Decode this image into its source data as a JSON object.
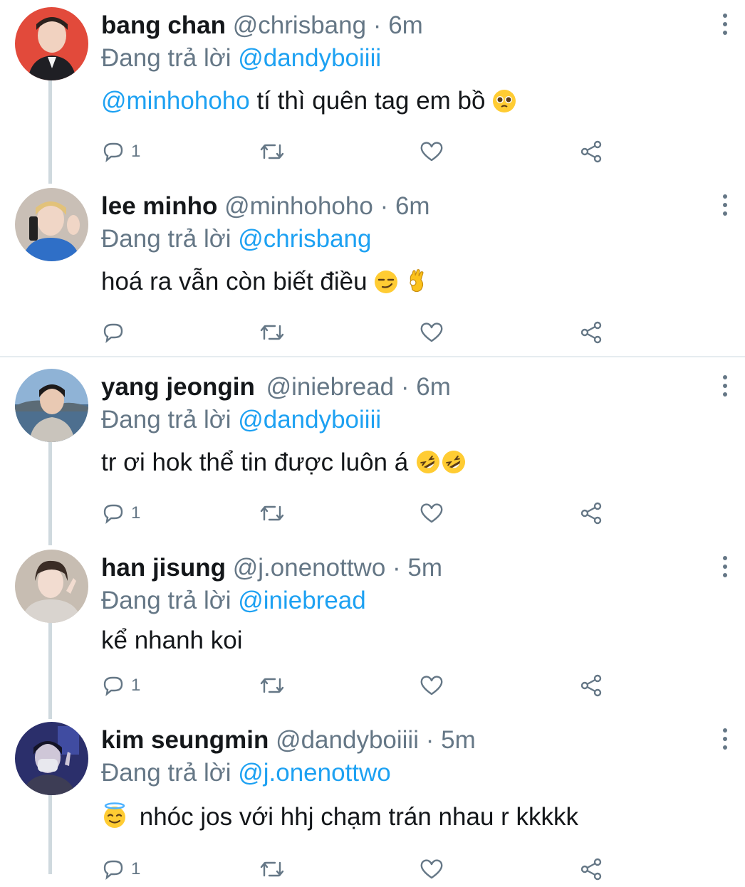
{
  "tweets": [
    {
      "name": "bang chan",
      "handle": "@chrisbang",
      "dot": "·",
      "time": "6m",
      "reply_prefix": "Đang trả lời",
      "reply_to": "@dandyboiiii",
      "text_mention": "@minhohoho",
      "text": " tí thì quên tag em bồ",
      "emojis": [
        "pleading-face"
      ],
      "reply_count": "1"
    },
    {
      "name": "lee minho",
      "handle": "@minhohoho",
      "dot": "·",
      "time": "6m",
      "reply_prefix": "Đang trả lời",
      "reply_to": "@chrisbang",
      "text_mention": "",
      "text": "hoá ra vẫn còn biết điều",
      "emojis": [
        "smirking-face",
        "ok-hand"
      ],
      "reply_count": ""
    },
    {
      "name": "yang jeongin",
      "handle": "@iniebread",
      "dot": "·",
      "time": "6m",
      "reply_prefix": "Đang trả lời",
      "reply_to": "@dandyboiiii",
      "text_mention": "",
      "text": "tr ơi hok thể tin được luôn á",
      "emojis": [
        "rofl-face",
        "rofl-face"
      ],
      "reply_count": "1"
    },
    {
      "name": "han jisung",
      "handle": "@j.onenottwo",
      "dot": "·",
      "time": "5m",
      "reply_prefix": "Đang trả lời",
      "reply_to": "@iniebread",
      "text_mention": "",
      "text": "kể nhanh koi",
      "emojis": [],
      "reply_count": "1"
    },
    {
      "name": "kim seungmin",
      "handle": "@dandyboiiii",
      "dot": "·",
      "time": "5m",
      "reply_prefix": "Đang trả lời",
      "reply_to": "@j.onenottwo",
      "text_mention": "",
      "text": "nhóc jos với hhj chạm trán nhau r kkkkk",
      "emojis": [
        "halo-face"
      ],
      "reply_count": "1"
    }
  ],
  "colors": {
    "link": "#1da1f2",
    "secondary": "#657786",
    "thread_line": "#cfd9de"
  },
  "icons": [
    "reply-icon",
    "retweet-icon",
    "like-icon",
    "share-icon",
    "more-icon"
  ]
}
